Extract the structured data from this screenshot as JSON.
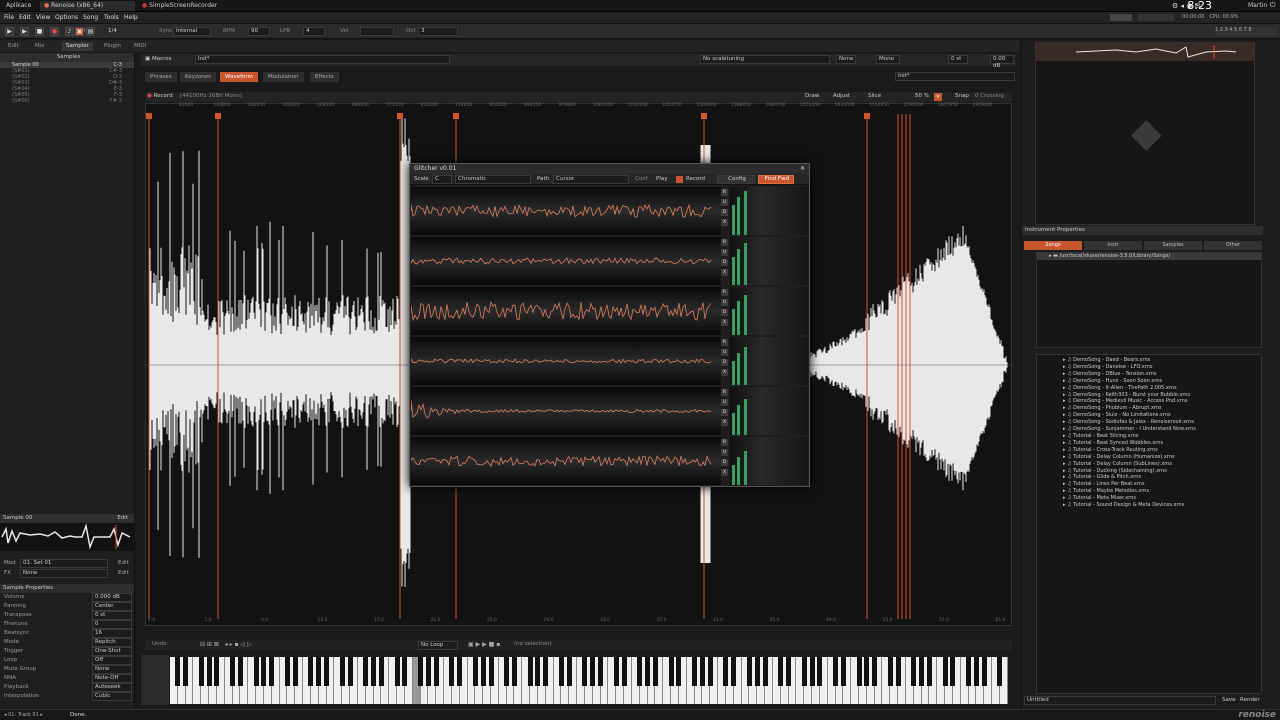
{
  "taskbar": {
    "items": [
      "Aplikace",
      "Renoise (x86_64)",
      "SimpleScreenRecorder"
    ],
    "clock": "8:23",
    "user": "Martin"
  },
  "menubar": [
    "File",
    "Edit",
    "View",
    "Options",
    "Song",
    "Tools",
    "Help"
  ],
  "transport": {
    "lines": "1/4",
    "sync_label": "Sync",
    "sync_value": "Internal",
    "bpm_label": "BPM",
    "bpm": "90",
    "lpb_label": "LPB",
    "lpb": "4",
    "vel_label": "Vel",
    "oct_label": "Oct",
    "oct": "3"
  },
  "main_tabs": [
    "Edit",
    "Mix",
    "Sampler",
    "Plugin",
    "MIDI"
  ],
  "sampler": {
    "macros_label": "Macros",
    "instrument": "Init*",
    "scaletuning": "No scaletuning",
    "none": "None",
    "mono": "Mono",
    "transpose": "0 st",
    "volume": "0.00 dB",
    "subtabs": [
      "Phrases",
      "Keyzones",
      "Waveform",
      "Modulation",
      "Effects"
    ],
    "active_subtab": "Waveform",
    "record_btn": "Record",
    "sample_info": "[44100Hz 16Bit Mono]",
    "draw": "Draw",
    "adjust": "Adjust",
    "slice": "Slice",
    "zoom": "50 %",
    "snap": "Snap",
    "zero_crossing": "0 Crossing",
    "ruler": [
      "81600",
      "163800",
      "244950",
      "326620",
      "408300",
      "489950",
      "571550",
      "653200",
      "734850",
      "816500",
      "898150",
      "979800",
      "1061450",
      "1143100",
      "1224750",
      "1306400",
      "1388050",
      "1469700",
      "1551350",
      "1633000",
      "1714650",
      "1796300",
      "1877950",
      "1959600"
    ],
    "bottom_ruler": [
      "1.0",
      "5.0",
      "9.0",
      "13.0",
      "17.0",
      "21.0",
      "25.0",
      "29.0",
      "33.0",
      "37.0",
      "41.0",
      "45.0",
      "49.0",
      "53.0",
      "57.0",
      "61.0"
    ],
    "undo": "Undo",
    "loop": "No Loop",
    "selection": "(no selection)"
  },
  "left_panel": {
    "samples_header": "Samples",
    "slots": [
      "Sample 00",
      "(S#01)",
      "(S#02)",
      "(S#03)",
      "(S#04)",
      "(S#05)",
      "(S#06)"
    ],
    "slot_notes": [
      "C-3",
      "C#-3",
      "D-3",
      "D#-3",
      "E-3",
      "F-3",
      "F#-3"
    ],
    "edit": "Edit",
    "mod_label": "Mod",
    "mod_value": "01: Set 01",
    "fx_label": "FX",
    "fx_value": "None",
    "props_header": "Sample Properties",
    "props": [
      {
        "label": "Volume",
        "value": "0.000 dB"
      },
      {
        "label": "Panning",
        "value": "Center"
      },
      {
        "label": "Transpose",
        "value": "0 st"
      },
      {
        "label": "Finetune",
        "value": "0"
      },
      {
        "label": "Beatsync",
        "value": "16"
      },
      {
        "label": "Mode",
        "value": "Repitch"
      },
      {
        "label": "Trigger",
        "value": "One-Shot"
      },
      {
        "label": "Loop",
        "value": "Off"
      },
      {
        "label": "Mute Group",
        "value": "None"
      },
      {
        "label": "NNA",
        "value": "Note-Off"
      },
      {
        "label": "Playback",
        "value": "Autoseek"
      },
      {
        "label": "Interpolation",
        "value": "Cubic"
      }
    ]
  },
  "dialog": {
    "title": "Glitcher v0.01",
    "scale_label": "Scale",
    "scale_key": "C",
    "scale_type": "Chromatic",
    "path_label": "Path",
    "path_value": "Cursor",
    "conf": "Conf",
    "play": "Play",
    "record": "Record",
    "config": "Config",
    "find_fwd": "Find Fwd",
    "btn_r": "R",
    "btn_u": "U",
    "btn_d": "D",
    "btn_x": "X"
  },
  "right_panel": {
    "instrument_props": "Instrument Properties",
    "browser_tabs": [
      "Songs",
      "Instr",
      "Samples",
      "Other"
    ],
    "path": "/usr/local/share/renoise-3.5.0/Library/Songs/",
    "files": [
      "DemoSong - Daed - Bears.xrns",
      "DemoSong - Danoise - LFO.xrns",
      "DemoSong - DBlue - Tension.xrns",
      "DemoSong - Hunz - Soon Soon.xrns",
      "DemoSong - It-Alien - ThePath 2.005.xrns",
      "DemoSong - Keith303 - Burst your Bubble.xrns",
      "DemoSong - Medievil Music - Access Pnd.xrns",
      "DemoSong - Phobium - Abrupt.xrns",
      "DemoSong - Sluiz - No Limitations.xrns",
      "DemoSong - Sodiufas & Jalex - Renoiservoir.xrns",
      "DemoSong - Sunjammer - I Understand Now.xrns",
      "Tutorial - Beat Slicing.xrns",
      "Tutorial - Beat Synced Wobbles.xrns",
      "Tutorial - Cross-Track Routing.xrns",
      "Tutorial - Delay Column (Humanize).xrns",
      "Tutorial - Delay Column (SubLines).xrns",
      "Tutorial - Ducking (Sidechaining).xrns",
      "Tutorial - Glide & Pitch.xrns",
      "Tutorial - Lines Per Beat.xrns",
      "Tutorial - Maybe Melodies.xrns",
      "Tutorial - Meta Mixer.xrns",
      "Tutorial - Sound Design & Meta Devices.xrns"
    ],
    "untitled": "Untitled",
    "save": "Save",
    "render": "Render"
  },
  "status": {
    "track": "01: Track 01",
    "message": "Done.",
    "brand": "renoise"
  },
  "colors": {
    "accent": "#c8552e",
    "marker": "#d2552a",
    "wave_fill": "#e8e8e8",
    "glitch_wave": "#d9805c",
    "meter": "#3aa060"
  }
}
